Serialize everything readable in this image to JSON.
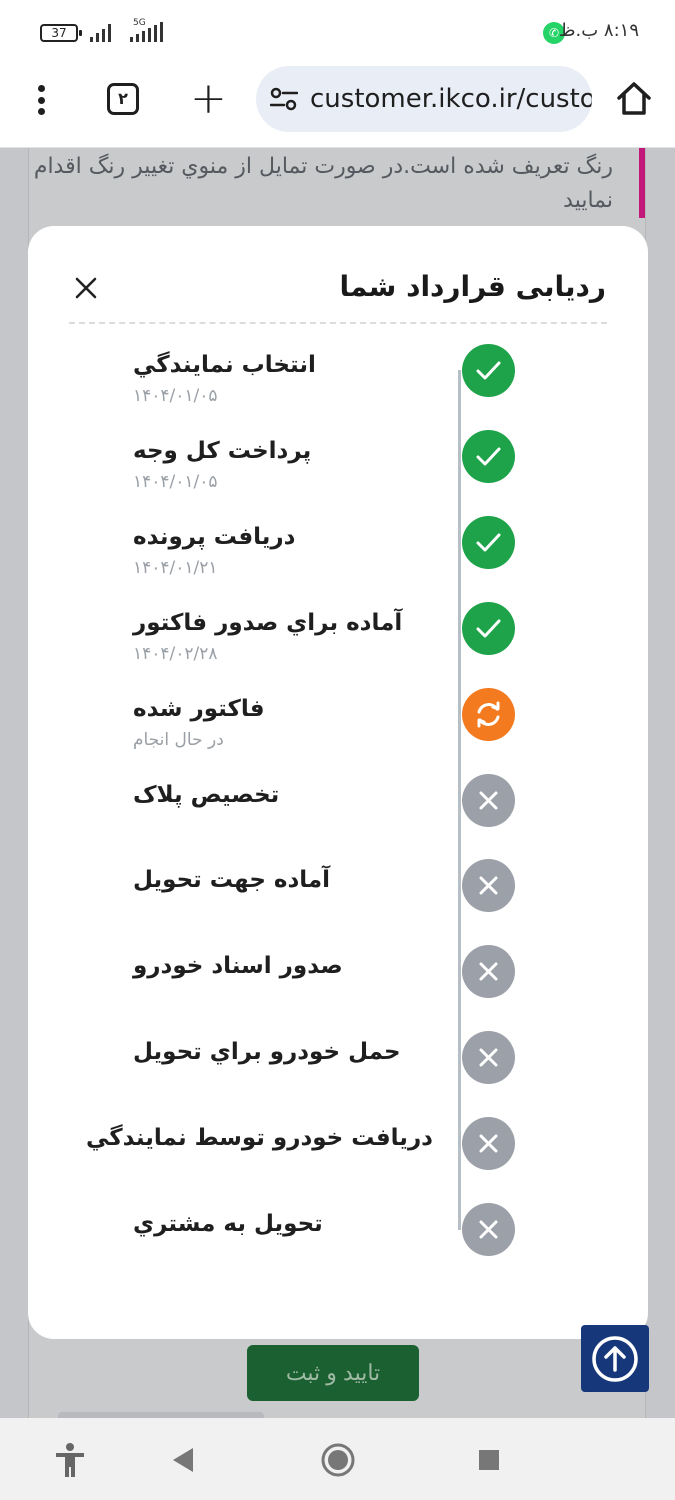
{
  "status_bar": {
    "battery": "37",
    "network": "5G",
    "time": "۸:۱۹ ب.ظ"
  },
  "browser": {
    "tab_count": "۲",
    "url": "customer.ikco.ir/customer"
  },
  "background": {
    "notice": "رنگ تعریف شده است.در صورت تمایل از منوي تغییر رنگ اقدام نمایید",
    "submit_label": "تایید و ثبت"
  },
  "modal": {
    "title": "ردیابی قرارداد شما",
    "steps": [
      {
        "label": "انتخاب نمايندگي",
        "sub": "۱۴۰۴/۰۱/۰۵",
        "status": "done"
      },
      {
        "label": "پرداخت کل وجه",
        "sub": "۱۴۰۴/۰۱/۰۵",
        "status": "done"
      },
      {
        "label": "دریافت پرونده",
        "sub": "۱۴۰۴/۰۱/۲۱",
        "status": "done"
      },
      {
        "label": "آماده براي صدور فاکتور",
        "sub": "۱۴۰۴/۰۲/۲۸",
        "status": "done"
      },
      {
        "label": "فاکتور شده",
        "sub": "در حال انجام",
        "status": "in-progress"
      },
      {
        "label": "تخصیص پلاک",
        "sub": "",
        "status": "pending"
      },
      {
        "label": "آماده جهت تحویل",
        "sub": "",
        "status": "pending"
      },
      {
        "label": "صدور اسناد خودرو",
        "sub": "",
        "status": "pending"
      },
      {
        "label": "حمل خودرو براي تحویل",
        "sub": "",
        "status": "pending"
      },
      {
        "label": "دریافت خودرو توسط نمايندگي",
        "sub": "",
        "status": "pending"
      },
      {
        "label": "تحویل به مشتري",
        "sub": "",
        "status": "pending"
      }
    ]
  },
  "colors": {
    "done": "#1ea34a",
    "in_progress": "#f47a1f",
    "pending": "#9ca0a8",
    "submit": "#1b6030",
    "scroll_top": "#16377a"
  },
  "icons": {
    "done": "check-icon",
    "in_progress": "refresh-icon",
    "pending": "x-icon"
  }
}
